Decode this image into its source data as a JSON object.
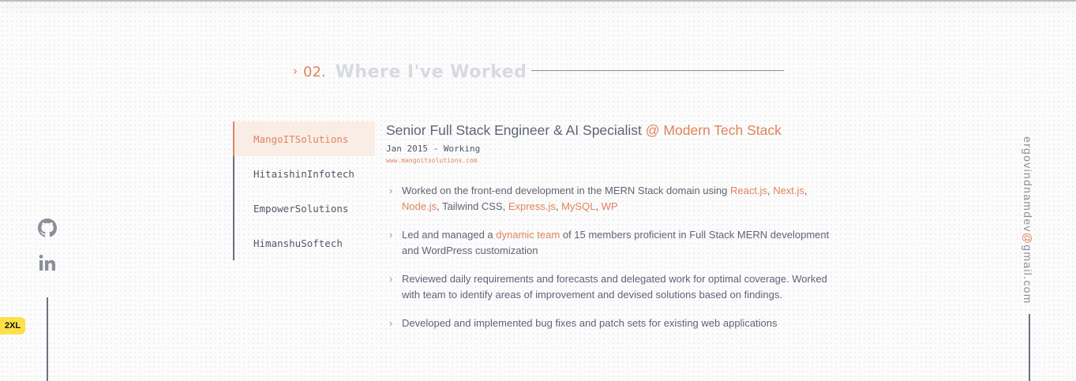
{
  "section": {
    "number": "02.",
    "title": "Where I've Worked"
  },
  "tabs": [
    {
      "label": "MangoITSolutions",
      "active": true
    },
    {
      "label": "HitaishinInfotech",
      "active": false
    },
    {
      "label": "EmpowerSolutions",
      "active": false
    },
    {
      "label": "HimanshuSoftech",
      "active": false
    }
  ],
  "job": {
    "title": "Senior Full Stack Engineer & AI Specialist",
    "company": "@ Modern Tech Stack",
    "dates": "Jan 2015 - Working",
    "website": "www.mangoitsolutions.com",
    "bullets": [
      {
        "p1": "Worked on the front-end development in the MERN Stack domain using ",
        "t_react": "React.js",
        "sep1": ", ",
        "t_next": "Next.js",
        "sep2": ", ",
        "t_node": "Node.js",
        "p2": ", Tailwind CSS, ",
        "t_express": "Express.js",
        "sep3": ", ",
        "t_mysql": "MySQL",
        "sep4": ", ",
        "t_wp": "WP"
      },
      {
        "p1": "Led and managed a ",
        "hl": "dynamic team",
        "p2": " of 15 members proficient in Full Stack MERN development and WordPress customization"
      },
      {
        "text": "Reviewed daily requirements and forecasts and delegated work for optimal coverage. Worked with team to identify areas of improvement and devised solutions based on findings."
      },
      {
        "text": "Developed and implemented bug fixes and patch sets for existing web applications"
      }
    ]
  },
  "social": {
    "icons": [
      "github-icon",
      "linkedin-icon"
    ]
  },
  "email": {
    "user": "ergovindnamdev",
    "at": "@",
    "domain": "gmail.com"
  },
  "badge": "2XL",
  "colors": {
    "accent": "#e0845c",
    "text": "#5e6472",
    "heading_muted": "#d7dae0",
    "badge": "#fde047"
  }
}
